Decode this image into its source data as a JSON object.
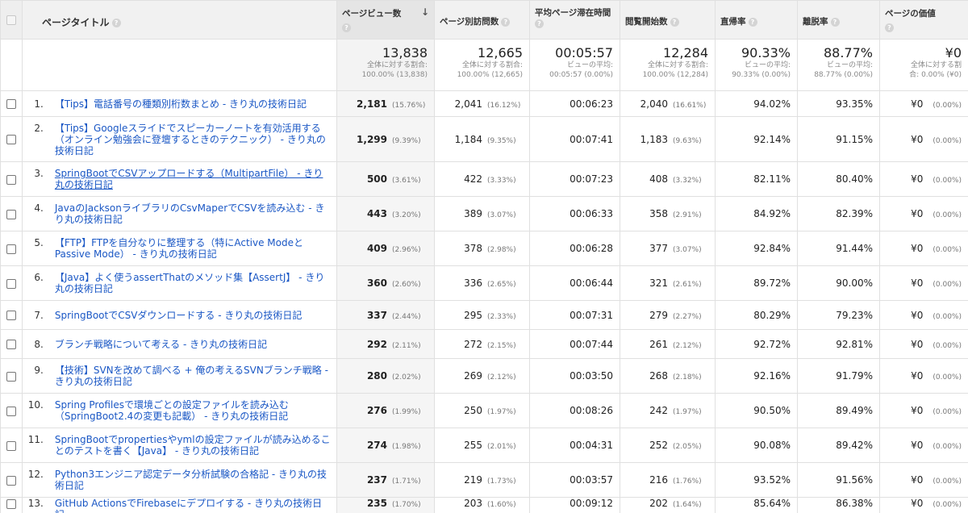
{
  "headers": {
    "title": "ページタイトル",
    "pageviews": "ページビュー数",
    "unique_pageviews": "ページ別訪問数",
    "avg_time": "平均ページ滞在時間",
    "entrances": "閲覧開始数",
    "bounce": "直帰率",
    "exit": "離脱率",
    "page_value": "ページの価値",
    "help_glyph": "?",
    "sort_arrow": "↓"
  },
  "summary": {
    "pageviews": {
      "value": "13,838",
      "sub1": "全体に対する割合:",
      "sub2": "100.00% (13,838)"
    },
    "unique_pageviews": {
      "value": "12,665",
      "sub1": "全体に対する割合:",
      "sub2": "100.00% (12,665)"
    },
    "avg_time": {
      "value": "00:05:57",
      "sub1": "ビューの平均:",
      "sub2": "00:05:57 (0.00%)"
    },
    "entrances": {
      "value": "12,284",
      "sub1": "全体に対する割合:",
      "sub2": "100.00% (12,284)"
    },
    "bounce": {
      "value": "90.33%",
      "sub1": "ビューの平均:",
      "sub2": "90.33% (0.00%)"
    },
    "exit": {
      "value": "88.77%",
      "sub1": "ビューの平均:",
      "sub2": "88.77% (0.00%)"
    },
    "page_value": {
      "value": "¥0",
      "sub1": "全体に対する割",
      "sub2": "合: 0.00% (¥0)"
    }
  },
  "rows": [
    {
      "rank": "1.",
      "title": "【Tips】電話番号の種類別桁数まとめ - きり丸の技術日記",
      "pv": "2,181",
      "pv_pct": "(15.76%)",
      "upv": "2,041",
      "upv_pct": "(16.12%)",
      "time": "00:06:23",
      "ent": "2,040",
      "ent_pct": "(16.61%)",
      "bounce": "94.02%",
      "exit": "93.35%",
      "val": "¥0",
      "val_pct": "(0.00%)"
    },
    {
      "rank": "2.",
      "title": "【Tips】Googleスライドでスピーカーノートを有効活用する（オンライン勉強会に登壇するときのテクニック） - きり丸の技術日記",
      "pv": "1,299",
      "pv_pct": "(9.39%)",
      "upv": "1,184",
      "upv_pct": "(9.35%)",
      "time": "00:07:41",
      "ent": "1,183",
      "ent_pct": "(9.63%)",
      "bounce": "92.14%",
      "exit": "91.15%",
      "val": "¥0",
      "val_pct": "(0.00%)"
    },
    {
      "rank": "3.",
      "title": "SpringBootでCSVアップロードする（MultipartFile） - きり丸の技術日記",
      "pv": "500",
      "pv_pct": "(3.61%)",
      "upv": "422",
      "upv_pct": "(3.33%)",
      "time": "00:07:23",
      "ent": "408",
      "ent_pct": "(3.32%)",
      "bounce": "82.11%",
      "exit": "80.40%",
      "val": "¥0",
      "val_pct": "(0.00%)"
    },
    {
      "rank": "4.",
      "title": "JavaのJacksonライブラリのCsvMaperでCSVを読み込む - きり丸の技術日記",
      "pv": "443",
      "pv_pct": "(3.20%)",
      "upv": "389",
      "upv_pct": "(3.07%)",
      "time": "00:06:33",
      "ent": "358",
      "ent_pct": "(2.91%)",
      "bounce": "84.92%",
      "exit": "82.39%",
      "val": "¥0",
      "val_pct": "(0.00%)"
    },
    {
      "rank": "5.",
      "title": "【FTP】FTPを自分なりに整理する（特にActive ModeとPassive Mode） - きり丸の技術日記",
      "pv": "409",
      "pv_pct": "(2.96%)",
      "upv": "378",
      "upv_pct": "(2.98%)",
      "time": "00:06:28",
      "ent": "377",
      "ent_pct": "(3.07%)",
      "bounce": "92.84%",
      "exit": "91.44%",
      "val": "¥0",
      "val_pct": "(0.00%)"
    },
    {
      "rank": "6.",
      "title": "【Java】よく使うassertThatのメソッド集【AssertJ】 - きり丸の技術日記",
      "pv": "360",
      "pv_pct": "(2.60%)",
      "upv": "336",
      "upv_pct": "(2.65%)",
      "time": "00:06:44",
      "ent": "321",
      "ent_pct": "(2.61%)",
      "bounce": "89.72%",
      "exit": "90.00%",
      "val": "¥0",
      "val_pct": "(0.00%)"
    },
    {
      "rank": "7.",
      "title": "SpringBootでCSVダウンロードする - きり丸の技術日記",
      "pv": "337",
      "pv_pct": "(2.44%)",
      "upv": "295",
      "upv_pct": "(2.33%)",
      "time": "00:07:31",
      "ent": "279",
      "ent_pct": "(2.27%)",
      "bounce": "80.29%",
      "exit": "79.23%",
      "val": "¥0",
      "val_pct": "(0.00%)"
    },
    {
      "rank": "8.",
      "title": "ブランチ戦略について考える - きり丸の技術日記",
      "pv": "292",
      "pv_pct": "(2.11%)",
      "upv": "272",
      "upv_pct": "(2.15%)",
      "time": "00:07:44",
      "ent": "261",
      "ent_pct": "(2.12%)",
      "bounce": "92.72%",
      "exit": "92.81%",
      "val": "¥0",
      "val_pct": "(0.00%)"
    },
    {
      "rank": "9.",
      "title": "【技術】SVNを改めて調べる + 俺の考えるSVNブランチ戦略 - きり丸の技術日記",
      "pv": "280",
      "pv_pct": "(2.02%)",
      "upv": "269",
      "upv_pct": "(2.12%)",
      "time": "00:03:50",
      "ent": "268",
      "ent_pct": "(2.18%)",
      "bounce": "92.16%",
      "exit": "91.79%",
      "val": "¥0",
      "val_pct": "(0.00%)"
    },
    {
      "rank": "10.",
      "title": "Spring Profilesで環境ごとの設定ファイルを読み込む（SpringBoot2.4の変更も記載） - きり丸の技術日記",
      "pv": "276",
      "pv_pct": "(1.99%)",
      "upv": "250",
      "upv_pct": "(1.97%)",
      "time": "00:08:26",
      "ent": "242",
      "ent_pct": "(1.97%)",
      "bounce": "90.50%",
      "exit": "89.49%",
      "val": "¥0",
      "val_pct": "(0.00%)"
    },
    {
      "rank": "11.",
      "title": "SpringBootでpropertiesやymlの設定ファイルが読み込めることのテストを書く【Java】 - きり丸の技術日記",
      "pv": "274",
      "pv_pct": "(1.98%)",
      "upv": "255",
      "upv_pct": "(2.01%)",
      "time": "00:04:31",
      "ent": "252",
      "ent_pct": "(2.05%)",
      "bounce": "90.08%",
      "exit": "89.42%",
      "val": "¥0",
      "val_pct": "(0.00%)"
    },
    {
      "rank": "12.",
      "title": "Python3エンジニア認定データ分析試験の合格記 - きり丸の技術日記",
      "pv": "237",
      "pv_pct": "(1.71%)",
      "upv": "219",
      "upv_pct": "(1.73%)",
      "time": "00:03:57",
      "ent": "216",
      "ent_pct": "(1.76%)",
      "bounce": "93.52%",
      "exit": "91.56%",
      "val": "¥0",
      "val_pct": "(0.00%)"
    },
    {
      "rank": "13.",
      "title": "GitHub ActionsでFirebaseにデプロイする - きり丸の技術日記",
      "pv": "235",
      "pv_pct": "(1.70%)",
      "upv": "203",
      "upv_pct": "(1.60%)",
      "time": "00:09:12",
      "ent": "202",
      "ent_pct": "(1.64%)",
      "bounce": "85.64%",
      "exit": "86.38%",
      "val": "¥0",
      "val_pct": "(0.00%)"
    }
  ]
}
